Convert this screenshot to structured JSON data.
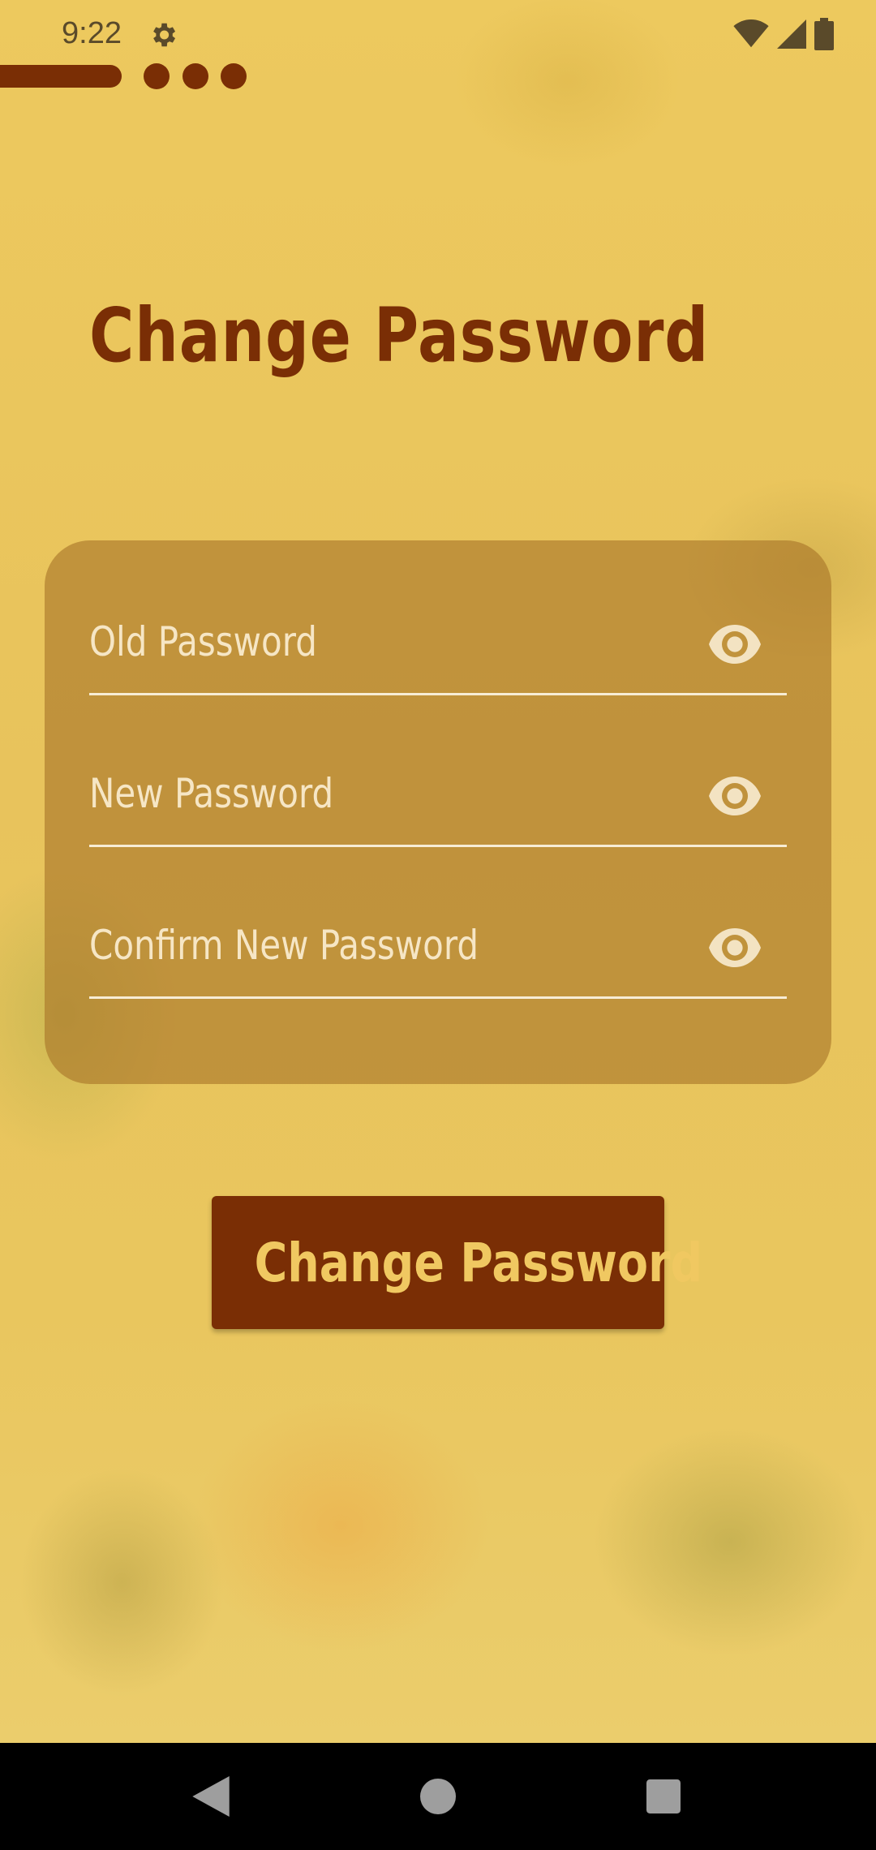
{
  "status_bar": {
    "time": "9:22",
    "icons": [
      "gear-icon",
      "wifi-icon",
      "signal-icon",
      "battery-icon"
    ]
  },
  "progress": {
    "steps_total": 4,
    "current_step": 1
  },
  "title": "Change Password",
  "form": {
    "fields": [
      {
        "label": "Old Password",
        "icon": "eye-icon"
      },
      {
        "label": "New Password",
        "icon": "eye-icon"
      },
      {
        "label": "Confirm New Password",
        "icon": "eye-icon"
      }
    ]
  },
  "submit_label": "Change Password",
  "navigation": {
    "icons": [
      "back-icon",
      "home-icon",
      "recents-icon"
    ]
  },
  "colors": {
    "accent": "#7a2e05",
    "background": "#e9c558",
    "card": "#b8893e",
    "field_text": "#f6e6c5",
    "button_text": "#f0c861"
  }
}
